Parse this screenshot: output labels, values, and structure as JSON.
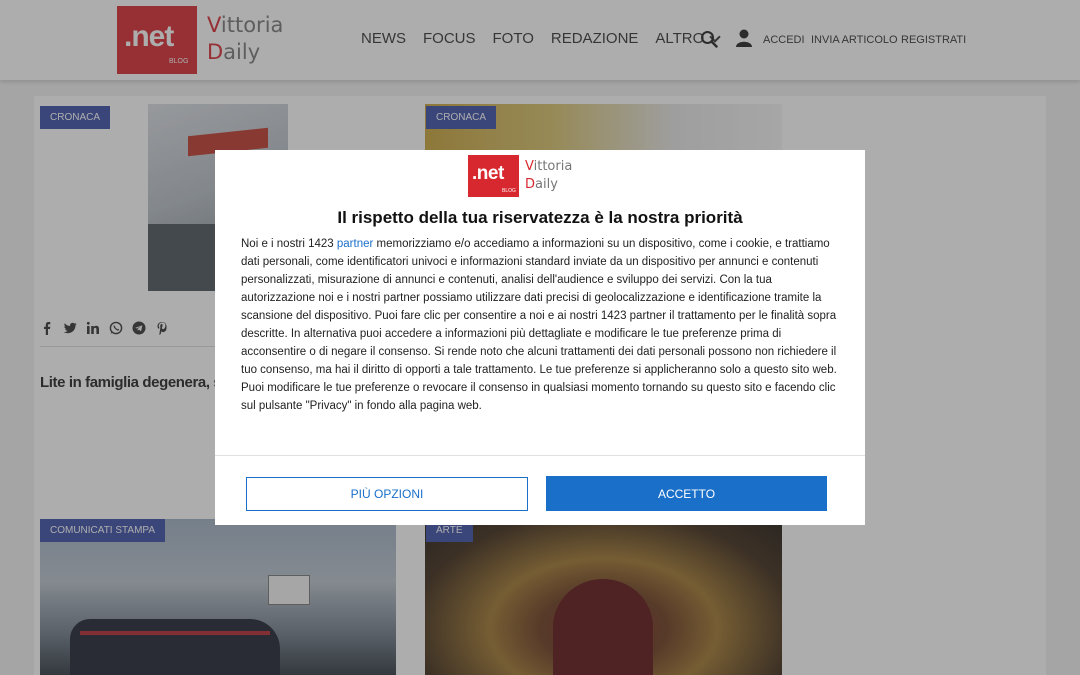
{
  "header": {
    "logo": {
      "net": ".net",
      "blog": "BLOG",
      "line1_cap": "V",
      "line1_rest": "ittoria",
      "line2_cap": "D",
      "line2_rest": "aily"
    },
    "nav": [
      "NEWS",
      "FOCUS",
      "FOTO",
      "REDAZIONE",
      "ALTRO"
    ],
    "links": {
      "login": "ACCEDI",
      "submit": "INVIA ARTICOLO",
      "register": "REGISTRATI"
    },
    "icons": {
      "search": "search-icon",
      "user": "user-icon",
      "chevron": "chevron-down-icon"
    }
  },
  "cards": [
    {
      "category": "CRONACA"
    },
    {
      "category": "CRONACA"
    },
    {
      "category": "COMUNICATI STAMPA"
    },
    {
      "category": "ARTE"
    }
  ],
  "share_icons": [
    "facebook-icon",
    "twitter-icon",
    "linkedin-icon",
    "whatsapp-icon",
    "telegram-icon",
    "pinterest-icon"
  ],
  "headline": "Lite in famiglia degenera, s",
  "consent": {
    "logo": {
      "net": ".net",
      "blog": "BLOG",
      "line1_cap": "V",
      "line1_rest": "ittoria",
      "line2_cap": "D",
      "line2_rest": "aily"
    },
    "title": "Il rispetto della tua riservatezza è la nostra priorità",
    "body_before_link": "Noi e i nostri 1423 ",
    "link": "partner",
    "body_after_link": " memorizziamo e/o accediamo a informazioni su un dispositivo, come i cookie, e trattiamo dati personali, come identificatori univoci e informazioni standard inviate da un dispositivo per annunci e contenuti personalizzati, misurazione di annunci e contenuti, analisi dell'audience e sviluppo dei servizi. Con la tua autorizzazione noi e i nostri partner possiamo utilizzare dati precisi di geolocalizzazione e identificazione tramite la scansione del dispositivo. Puoi fare clic per consentire a noi e ai nostri 1423 partner il trattamento per le finalità sopra descritte. In alternativa puoi accedere a informazioni più dettagliate e modificare le tue preferenze prima di acconsentire o di negare il consenso. Si rende noto che alcuni trattamenti dei dati personali possono non richiedere il tuo consenso, ma hai il diritto di opporti a tale trattamento. Le tue preferenze si applicheranno solo a questo sito web. Puoi modificare le tue preferenze o revocare il consenso in qualsiasi momento tornando su questo sito e facendo clic sul pulsante \"Privacy\" in fondo alla pagina web.",
    "more_options": "PIÙ OPZIONI",
    "accept": "ACCETTO"
  }
}
